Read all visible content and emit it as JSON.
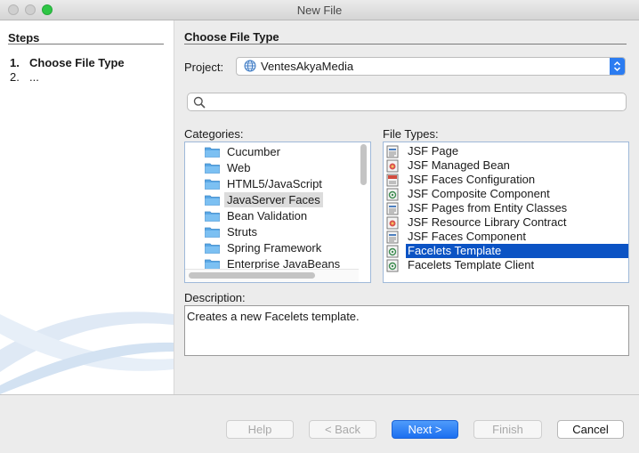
{
  "window": {
    "title": "New File"
  },
  "steps": {
    "title": "Steps",
    "items": [
      {
        "num": "1.",
        "label": "Choose File Type"
      },
      {
        "num": "2.",
        "label": "..."
      }
    ]
  },
  "main": {
    "section_title": "Choose File Type",
    "project_label": "Project:",
    "project_value": "VentesAkyaMedia",
    "search_value": "",
    "categories_label": "Categories:",
    "file_types_label": "File Types:",
    "categories": [
      "Cucumber",
      "Web",
      "HTML5/JavaScript",
      "JavaServer Faces",
      "Bean Validation",
      "Struts",
      "Spring Framework",
      "Enterprise JavaBeans"
    ],
    "selected_category": "JavaServer Faces",
    "file_types": [
      {
        "label": "JSF Page",
        "icon": "jsf-page-icon"
      },
      {
        "label": "JSF Managed Bean",
        "icon": "bean-icon"
      },
      {
        "label": "JSF Faces Configuration",
        "icon": "xml-config-icon"
      },
      {
        "label": "JSF Composite Component",
        "icon": "component-icon"
      },
      {
        "label": "JSF Pages from Entity Classes",
        "icon": "jsf-page-icon"
      },
      {
        "label": "JSF Resource Library Contract",
        "icon": "bean-icon"
      },
      {
        "label": "JSF Faces Component",
        "icon": "jsf-page-icon"
      },
      {
        "label": "Facelets Template",
        "icon": "facelets-icon"
      },
      {
        "label": "Facelets Template Client",
        "icon": "facelets-icon"
      }
    ],
    "selected_file_type": "Facelets Template",
    "description_label": "Description:",
    "description": "Creates a new Facelets template."
  },
  "buttons": {
    "help": "Help",
    "back": "< Back",
    "next": "Next >",
    "finish": "Finish",
    "cancel": "Cancel"
  },
  "colors": {
    "accent": "#1c6ff0",
    "selection": "#0b53c4",
    "folder": "#5aa8e6"
  }
}
